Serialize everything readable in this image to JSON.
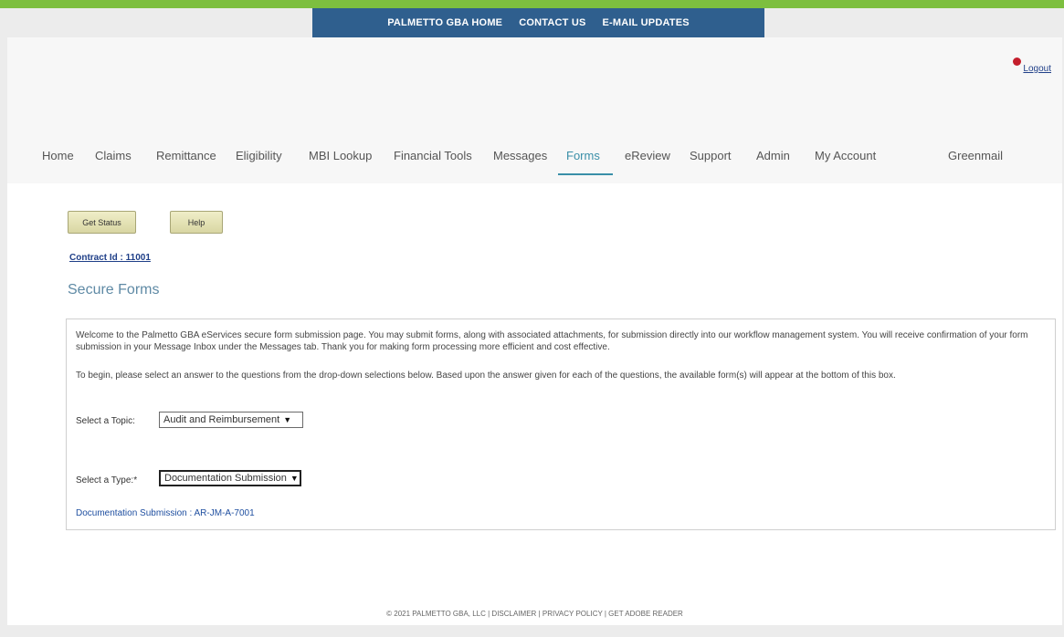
{
  "top_links": [
    "PALMETTO GBA HOME",
    "CONTACT US",
    "E-MAIL UPDATES"
  ],
  "logout_label": "Logout",
  "nav": {
    "items": [
      "Home",
      "Claims",
      "Remittance",
      "Eligibility",
      "MBI Lookup",
      "Financial Tools",
      "Messages",
      "Forms",
      "eReview",
      "Support",
      "Admin",
      "My Account",
      "Greenmail"
    ],
    "active": "Forms"
  },
  "buttons": {
    "get_status": "Get Status",
    "help": "Help"
  },
  "contract_id": "Contract Id : 11001",
  "section_title": "Secure Forms",
  "intro_paragraph": "Welcome to the Palmetto GBA eServices secure form submission page. You may submit forms, along with associated attachments, for submission directly into our workflow management system. You will receive confirmation of your form submission in your Message Inbox under the Messages tab. Thank you for making form processing more efficient and cost effective.",
  "instruction_paragraph": "To begin, please select an answer to the questions from the drop-down selections below. Based upon the answer given for each of the questions, the available form(s) will appear at the bottom of this box.",
  "topic": {
    "label": "Select a Topic:",
    "value": "Audit and Reimbursement"
  },
  "type": {
    "label": "Select a Type:*",
    "value": "Documentation Submission"
  },
  "result_link": "Documentation Submission : AR-JM-A-7001",
  "footer": "© 2021 PALMETTO GBA, LLC | DISCLAIMER | PRIVACY POLICY | GET ADOBE READER",
  "colors": {
    "green_bar": "#7dbf3f",
    "top_nav_bg": "#2f5f8e",
    "active_nav": "#3a8fa8",
    "link_blue": "#1f3f88",
    "button_bg": "#e4e1b3"
  }
}
